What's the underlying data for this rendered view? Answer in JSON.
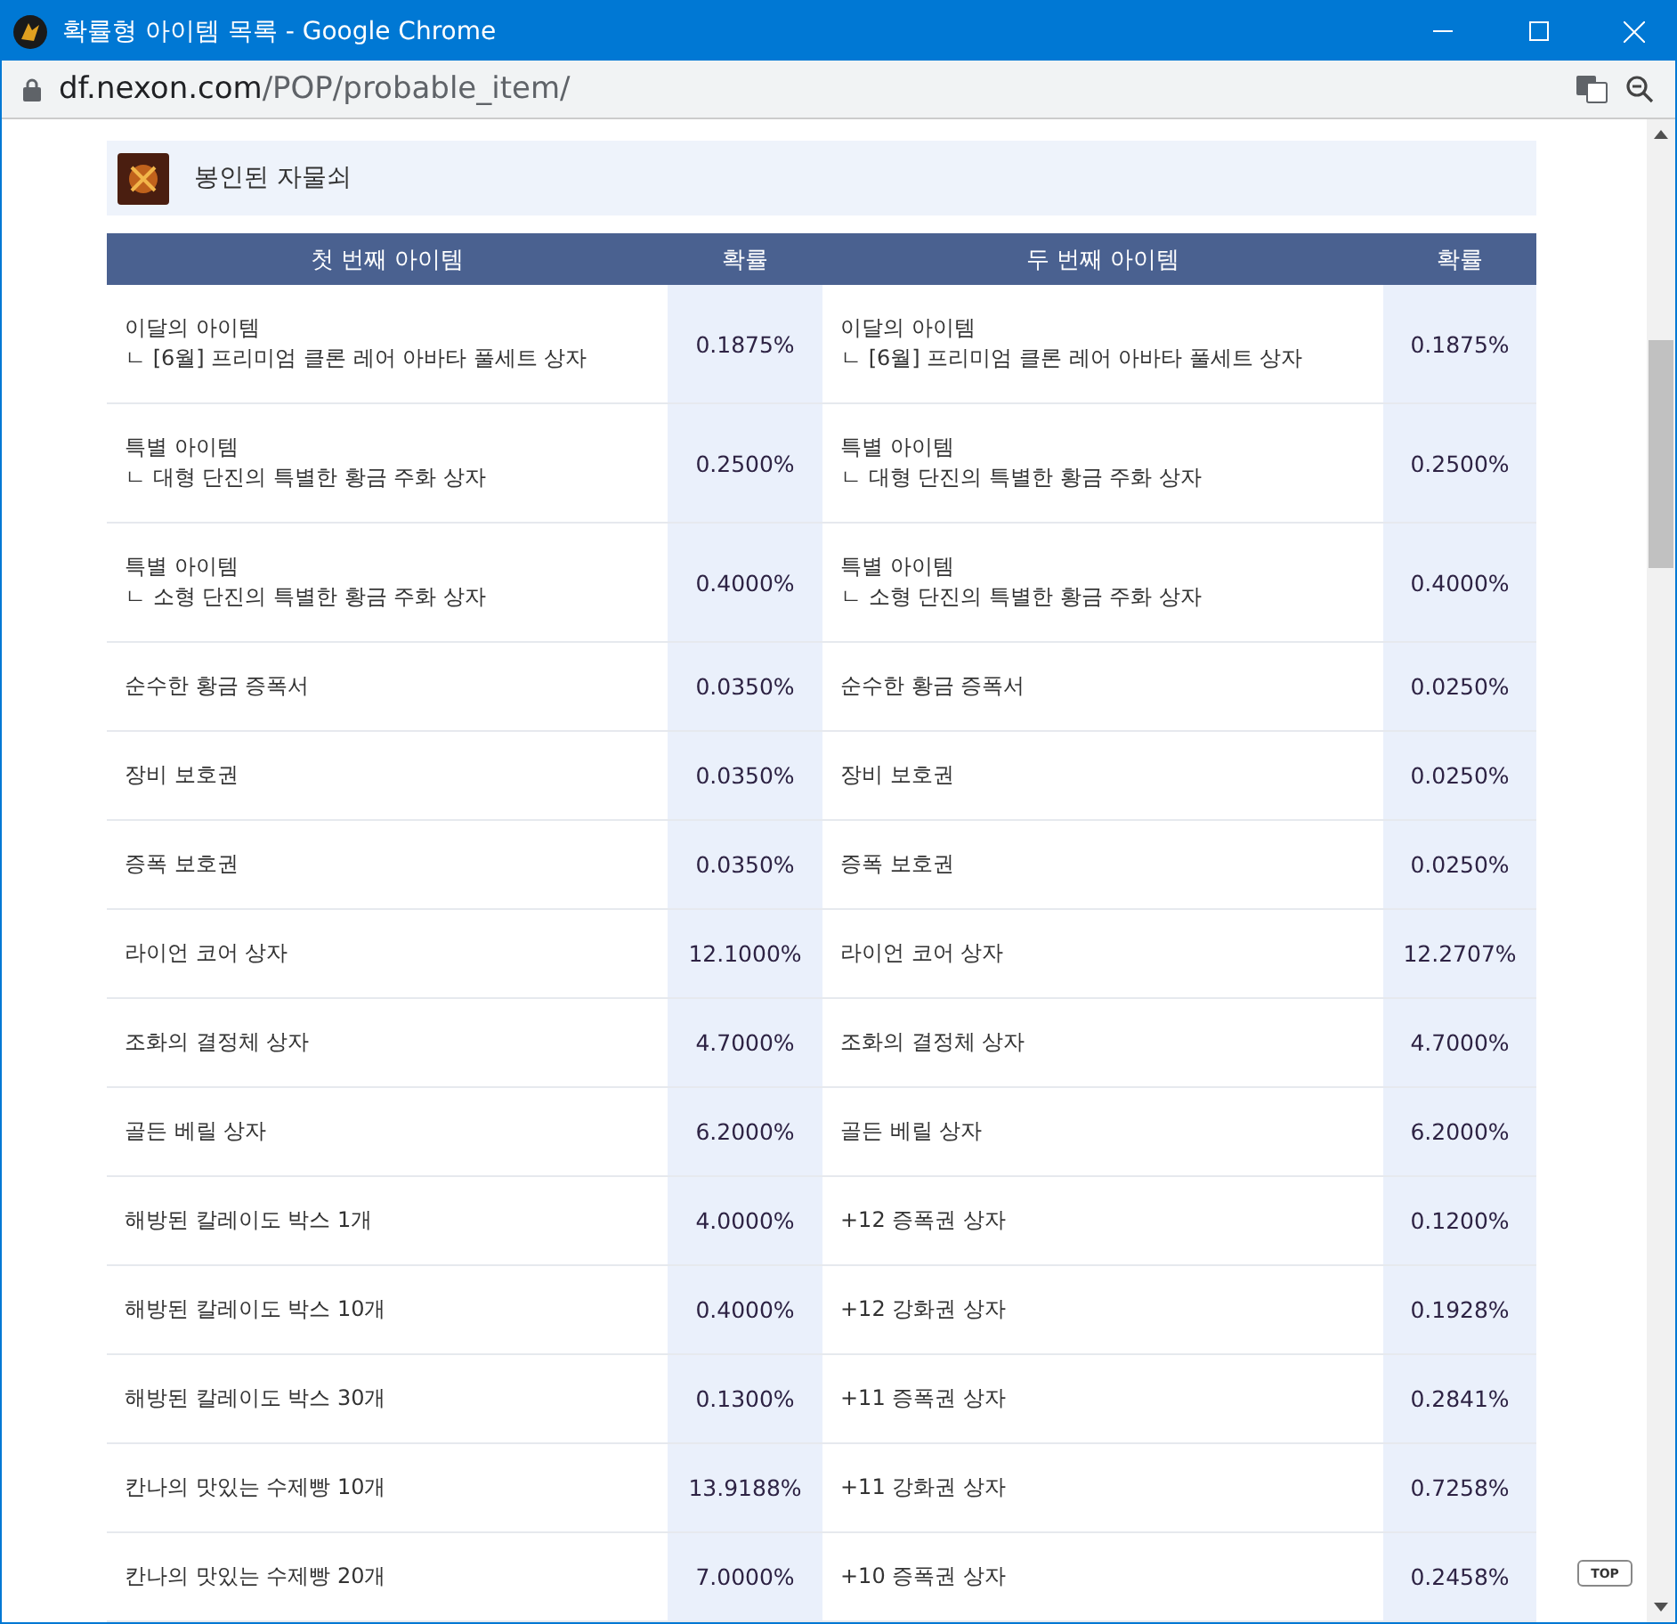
{
  "window": {
    "title": "확률형 아이템 목록 - Google Chrome"
  },
  "address_bar": {
    "domain": "df.nexon.com",
    "path": "/POP/probable_item/"
  },
  "section": {
    "title": "봉인된 자물쇠"
  },
  "table": {
    "columns": [
      "첫 번째 아이템",
      "확률",
      "두 번째 아이템",
      "확률"
    ],
    "rows": [
      {
        "first": {
          "name": "이달의 아이템",
          "sub": "ㄴ [6월] 프리미엄 클론 레어 아바타 풀세트 상자"
        },
        "first_prob": "0.1875%",
        "second": {
          "name": "이달의 아이템",
          "sub": "ㄴ [6월] 프리미엄 클론 레어 아바타 풀세트 상자"
        },
        "second_prob": "0.1875%"
      },
      {
        "first": {
          "name": "특별 아이템",
          "sub": "ㄴ 대형 단진의 특별한 황금 주화 상자"
        },
        "first_prob": "0.2500%",
        "second": {
          "name": "특별 아이템",
          "sub": "ㄴ 대형 단진의 특별한 황금 주화 상자"
        },
        "second_prob": "0.2500%"
      },
      {
        "first": {
          "name": "특별 아이템",
          "sub": "ㄴ 소형 단진의 특별한 황금 주화 상자"
        },
        "first_prob": "0.4000%",
        "second": {
          "name": "특별 아이템",
          "sub": "ㄴ 소형 단진의 특별한 황금 주화 상자"
        },
        "second_prob": "0.4000%"
      },
      {
        "first": {
          "name": "순수한 황금 증폭서"
        },
        "first_prob": "0.0350%",
        "second": {
          "name": "순수한 황금 증폭서"
        },
        "second_prob": "0.0250%"
      },
      {
        "first": {
          "name": "장비 보호권"
        },
        "first_prob": "0.0350%",
        "second": {
          "name": "장비 보호권"
        },
        "second_prob": "0.0250%"
      },
      {
        "first": {
          "name": "증폭 보호권"
        },
        "first_prob": "0.0350%",
        "second": {
          "name": "증폭 보호권"
        },
        "second_prob": "0.0250%"
      },
      {
        "first": {
          "name": "라이언 코어 상자"
        },
        "first_prob": "12.1000%",
        "second": {
          "name": "라이언 코어 상자"
        },
        "second_prob": "12.2707%"
      },
      {
        "first": {
          "name": "조화의 결정체 상자"
        },
        "first_prob": "4.7000%",
        "second": {
          "name": "조화의 결정체 상자"
        },
        "second_prob": "4.7000%"
      },
      {
        "first": {
          "name": "골든 베릴 상자"
        },
        "first_prob": "6.2000%",
        "second": {
          "name": "골든 베릴 상자"
        },
        "second_prob": "6.2000%"
      },
      {
        "first": {
          "name": "해방된 칼레이도 박스 1개"
        },
        "first_prob": "4.0000%",
        "second": {
          "name": "+12 증폭권 상자"
        },
        "second_prob": "0.1200%"
      },
      {
        "first": {
          "name": "해방된 칼레이도 박스 10개"
        },
        "first_prob": "0.4000%",
        "second": {
          "name": "+12 강화권 상자"
        },
        "second_prob": "0.1928%"
      },
      {
        "first": {
          "name": "해방된 칼레이도 박스 30개"
        },
        "first_prob": "0.1300%",
        "second": {
          "name": "+11 증폭권 상자"
        },
        "second_prob": "0.2841%"
      },
      {
        "first": {
          "name": "칸나의 맛있는 수제빵 10개"
        },
        "first_prob": "13.9188%",
        "second": {
          "name": "+11 강화권 상자"
        },
        "second_prob": "0.7258%"
      },
      {
        "first": {
          "name": "칸나의 맛있는 수제빵 20개"
        },
        "first_prob": "7.0000%",
        "second": {
          "name": "+10 증폭권 상자"
        },
        "second_prob": "0.2458%"
      }
    ]
  },
  "top_button": "TOP"
}
